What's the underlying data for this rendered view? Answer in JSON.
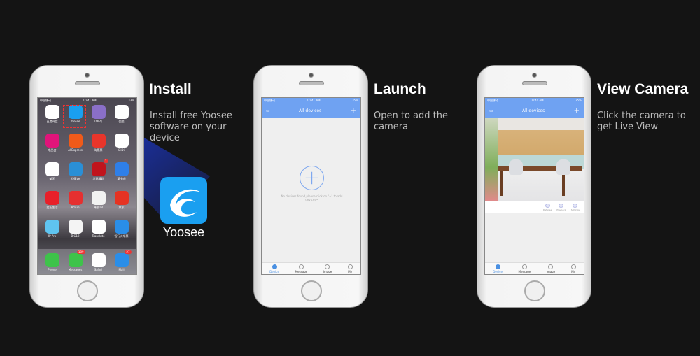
{
  "steps": [
    {
      "title": "Install",
      "description": "Install free Yoosee software on your device"
    },
    {
      "title": "Launch",
      "description": "Open to add the camera"
    },
    {
      "title": "View Camera",
      "description": "Click the camera to get Live View"
    }
  ],
  "featured_app": {
    "name": "Yoosee",
    "color": "#1a9ff0"
  },
  "home_screen": {
    "time": "10:41 AM",
    "carrier": "中国移动",
    "battery": "33%",
    "apps": [
      {
        "label": "百度网盘",
        "color": "#ffffff"
      },
      {
        "label": "Yoosee",
        "color": "#1a9ff0"
      },
      {
        "label": "DMZJ",
        "color": "#8a6fc8"
      },
      {
        "label": "优酷",
        "color": "#ffffff"
      },
      {
        "label": "唯品会",
        "color": "#e0147a"
      },
      {
        "label": "AliExpress",
        "color": "#f05a1a"
      },
      {
        "label": "淘票票",
        "color": "#e8352b"
      },
      {
        "label": "DiDi",
        "color": "#ffffff"
      },
      {
        "label": "美团",
        "color": "#ffffff"
      },
      {
        "label": "XMEye",
        "color": "#2a8fd6"
      },
      {
        "label": "发现精彩",
        "color": "#c0141c",
        "badge": "1"
      },
      {
        "label": "英卡吧",
        "color": "#2f7fe8"
      },
      {
        "label": "爱上生活",
        "color": "#e8202a"
      },
      {
        "label": "AcFun",
        "color": "#e53030"
      },
      {
        "label": "韩剧TV",
        "color": "#f2f2f2"
      },
      {
        "label": "京东",
        "color": "#e53322"
      },
      {
        "label": "IP Pro",
        "color": "#5fc4f0"
      },
      {
        "label": "BIG12",
        "color": "#f4f4f4"
      },
      {
        "label": "Translate",
        "color": "#ffffff"
      },
      {
        "label": "智行火车票",
        "color": "#2a8ee8"
      }
    ],
    "dock": [
      {
        "label": "Phone",
        "color": "#3ec34a"
      },
      {
        "label": "Messages",
        "color": "#3ec34a",
        "badge": "189"
      },
      {
        "label": "Safari",
        "color": "#ffffff"
      },
      {
        "label": "Mail",
        "color": "#2a8ee8",
        "badge": "27"
      }
    ]
  },
  "launch_screen": {
    "time": "10:41 AM",
    "carrier": "中国移动",
    "battery": "35%",
    "header": "All devices",
    "empty_message": "No devices found,please click on \"+\" to add devices~"
  },
  "camera_screen": {
    "time": "10:44 AM",
    "carrier": "中国移动",
    "battery": "35%",
    "header": "All devices",
    "actions": [
      "Defense",
      "Playback",
      "Settings"
    ]
  },
  "tabs": [
    "Device",
    "Message",
    "Image",
    "My"
  ],
  "accent": "#6fa2f2"
}
